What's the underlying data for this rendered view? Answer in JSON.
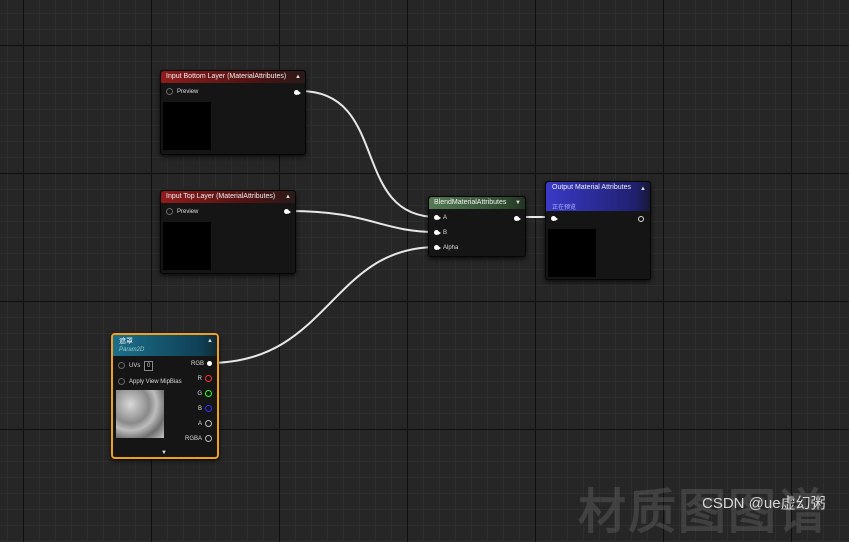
{
  "nodes": {
    "bottom_layer": {
      "title": "Input Bottom Layer (MaterialAttributes)",
      "pin_label": "Preview"
    },
    "top_layer": {
      "title": "Input Top Layer (MaterialAttributes)",
      "pin_label": "Preview"
    },
    "blend": {
      "title": "BlendMaterialAttributes",
      "pins": [
        "A",
        "B",
        "Alpha"
      ]
    },
    "output": {
      "title": "Output Material Attributes",
      "subtitle": "正在预览"
    },
    "mask": {
      "title": "遮罩",
      "subtitle": "Param2D",
      "uvs_label": "UVs",
      "uvs_value": "0",
      "mip_label": "Apply View MipBias",
      "outputs": [
        {
          "label": "RGB",
          "color": "#ffffff"
        },
        {
          "label": "R",
          "color": "#ff3030"
        },
        {
          "label": "G",
          "color": "#30ff30"
        },
        {
          "label": "B",
          "color": "#3030ff"
        },
        {
          "label": "A",
          "color": "#cccccc"
        },
        {
          "label": "RGBA",
          "color": "#cccccc"
        }
      ]
    }
  },
  "watermark": {
    "big_text": "材质图图谱",
    "csdn": "CSDN @ue虚幻粥"
  },
  "colors": {
    "wire": "#e8e8e8",
    "mask_border": "#f0a020",
    "output_header": "#3030a0"
  }
}
